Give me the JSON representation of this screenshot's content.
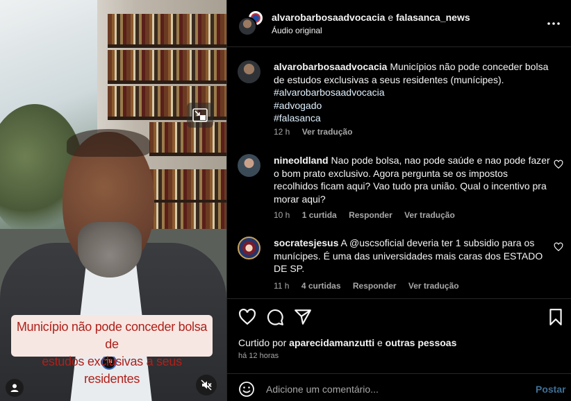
{
  "video": {
    "caption_line1": "Município não pode conceder bolsa de",
    "caption_line2": "estudos exclusivas a seus residentes",
    "pin_text": "TN",
    "icons": {
      "pip": "picture-in-picture-icon",
      "user_tag": "user-tag-icon",
      "mute": "muted-speaker-icon"
    }
  },
  "header": {
    "user1": "alvarobarbosaadvocacia",
    "conjunction": "e",
    "user2": "falasanca_news",
    "audio": "Áudio original",
    "more_icon": "more-options-icon"
  },
  "comments": [
    {
      "user": "alvarobarbosaadvocacia",
      "text": "Municípios não pode conceder bolsa de estudos exclusivas a seus residentes (munícipes).",
      "hashtags": [
        "#alvarobarbosaadvocacia",
        "#advogado",
        "#falasanca"
      ],
      "time": "12 h",
      "likes": "",
      "reply": "",
      "translate": "Ver tradução"
    },
    {
      "user": "nineoldland",
      "text": "Nao pode bolsa, nao pode saúde e nao pode fazer o bom prato exclusivo. Agora pergunta se os impostos recolhidos ficam aqui? Vao tudo pra união. Qual o incentivo pra morar aqui?",
      "time": "10 h",
      "likes": "1 curtida",
      "reply": "Responder",
      "translate": "Ver tradução"
    },
    {
      "user": "socratesjesus",
      "text": "A @uscsoficial deveria ter 1 subsidio para os munícipes. É uma das universidades mais caras dos ESTADO DE SP.",
      "time": "11 h",
      "likes": "4 curtidas",
      "reply": "Responder",
      "translate": "Ver tradução"
    }
  ],
  "actions": {
    "liked_prefix": "Curtido por",
    "liked_user": "aparecidamanzutti",
    "liked_conj": "e",
    "liked_others": "outras pessoas",
    "ago": "há 12 horas"
  },
  "composer": {
    "placeholder": "Adicione um comentário...",
    "post_label": "Postar"
  },
  "colors": {
    "accent_link": "#e0f1ff",
    "post_disabled": "#3f6f96",
    "muted_text": "#a8a8a8",
    "caption_red": "#b0201a"
  }
}
